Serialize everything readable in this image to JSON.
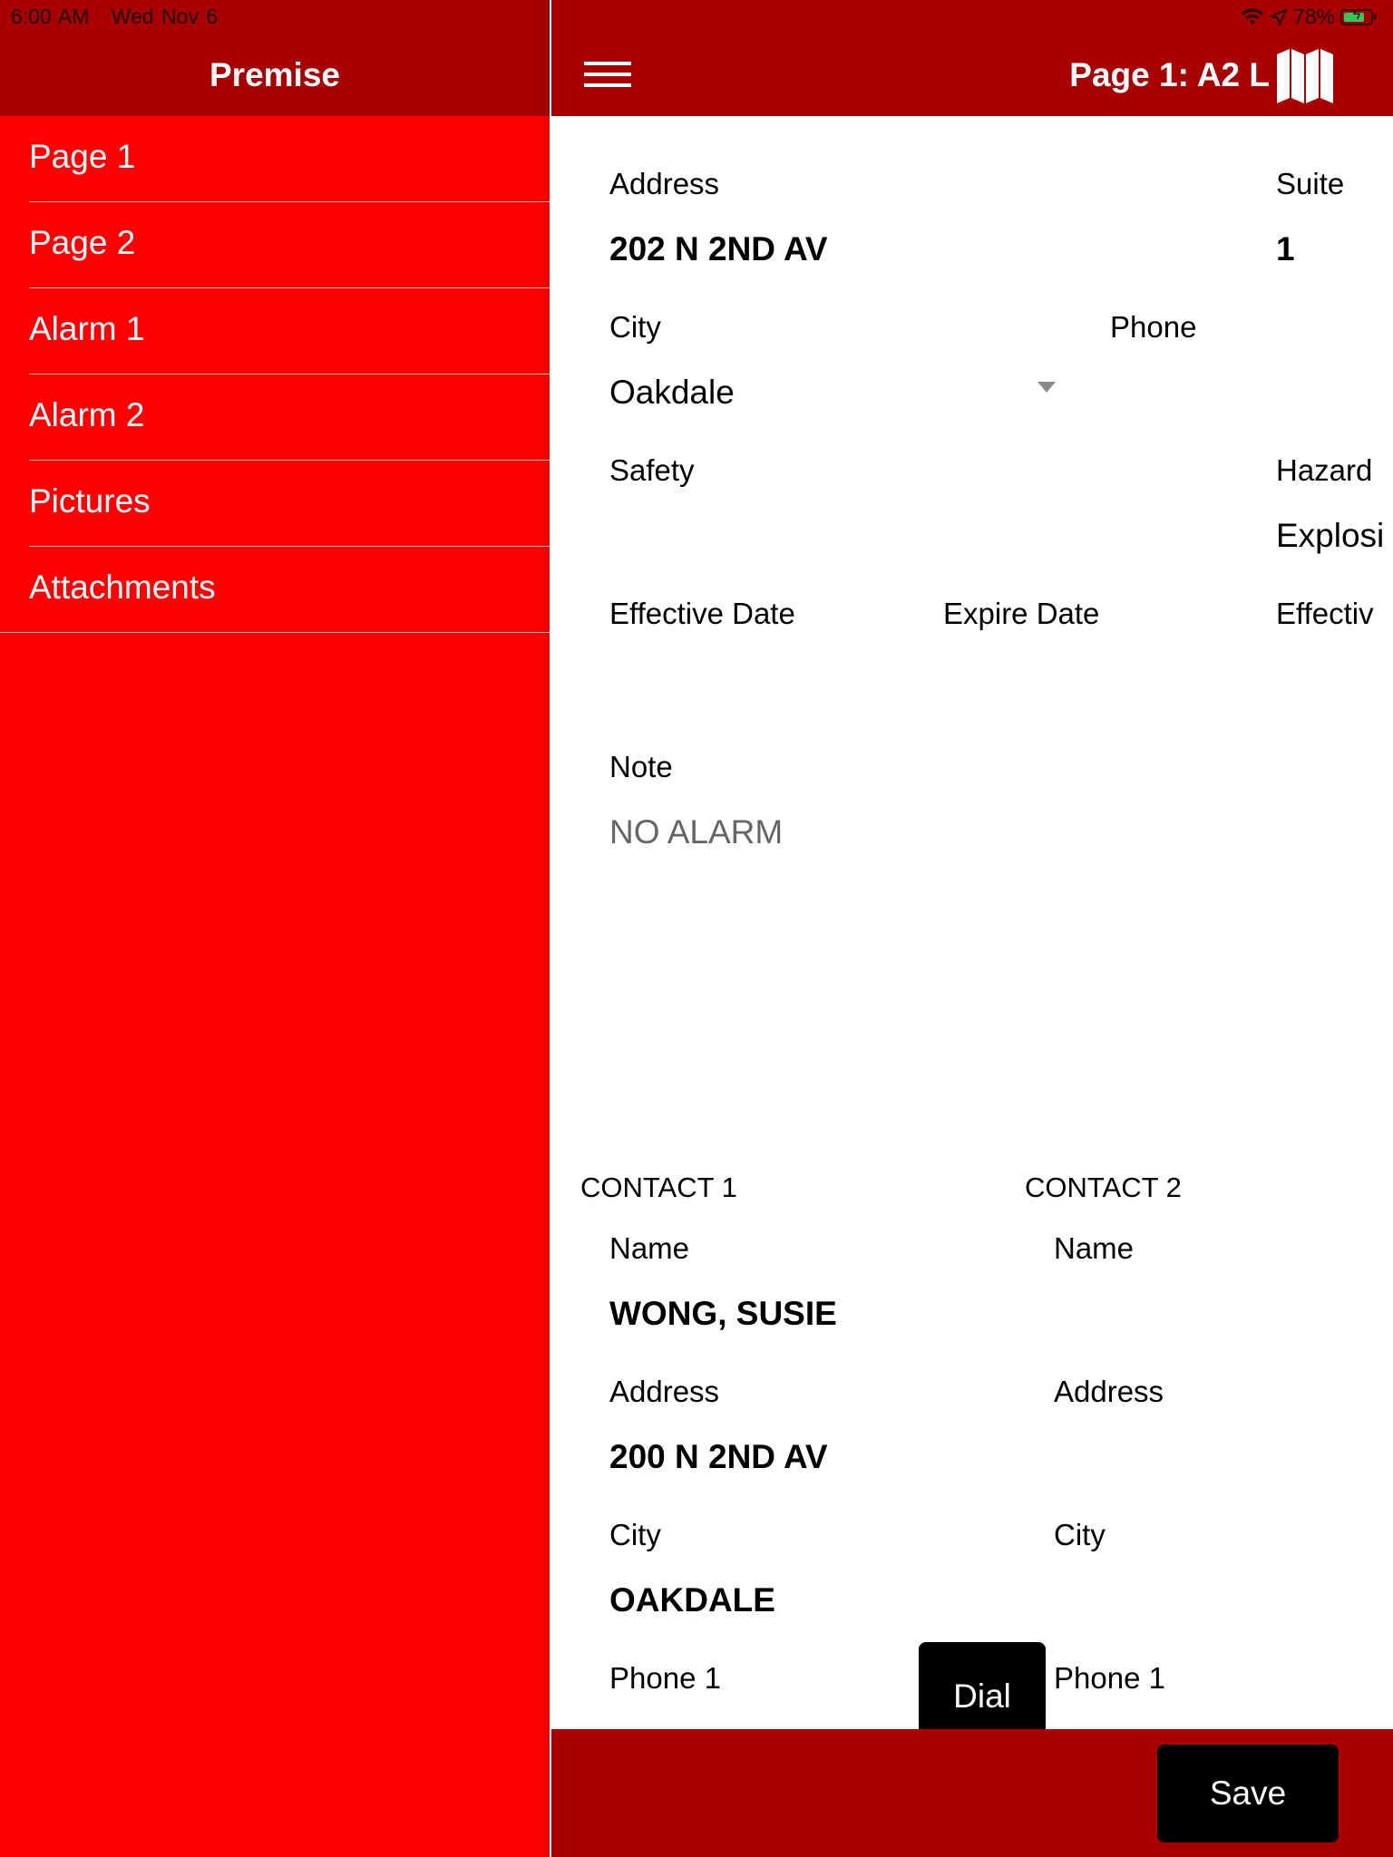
{
  "status_bar": {
    "time": "6:00 AM",
    "date": "Wed Nov 6",
    "battery_percent": "78%",
    "battery_level": 0.78,
    "icons": [
      "wifi-icon",
      "location-arrow-icon",
      "battery-charging-icon"
    ]
  },
  "sidebar": {
    "title": "Premise",
    "items": [
      {
        "label": "Page 1"
      },
      {
        "label": "Page 2"
      },
      {
        "label": "Alarm 1"
      },
      {
        "label": "Alarm 2"
      },
      {
        "label": "Pictures"
      },
      {
        "label": "Attachments"
      }
    ]
  },
  "header": {
    "title": "Page 1: A2 L",
    "menu_icon": "hamburger-menu-icon",
    "map_icon": "folded-map-icon"
  },
  "premise": {
    "address_label": "Address",
    "address_value": "202 N 2ND AV",
    "suite_label": "Suite",
    "suite_value": "1",
    "city_label": "City",
    "city_value": "Oakdale",
    "phone_label": "Phone",
    "phone_value": "",
    "safety_label": "Safety",
    "safety_value": "",
    "hazard_label": "Hazard",
    "hazard_value": "Explosi",
    "effective_date_label": "Effective Date",
    "expire_date_label": "Expire Date",
    "effective_date_2_label": "Effectiv",
    "note_label": "Note",
    "note_value": "NO ALARM"
  },
  "contact1": {
    "header": "CONTACT 1",
    "name_label": "Name",
    "name_value": "WONG, SUSIE",
    "address_label": "Address",
    "address_value": "200 N 2ND AV",
    "city_label": "City",
    "city_value": "OAKDALE",
    "phone1_label": "Phone 1"
  },
  "contact2": {
    "header": "CONTACT 2",
    "name_label": "Name",
    "address_label": "Address",
    "city_label": "City",
    "phone1_label": "Phone 1"
  },
  "buttons": {
    "dial": "Dial",
    "save": "Save"
  },
  "colors": {
    "header_dark_red": "#a80000",
    "sidebar_red": "#ff0000",
    "button_black": "#000000",
    "text_muted": "#666666"
  }
}
